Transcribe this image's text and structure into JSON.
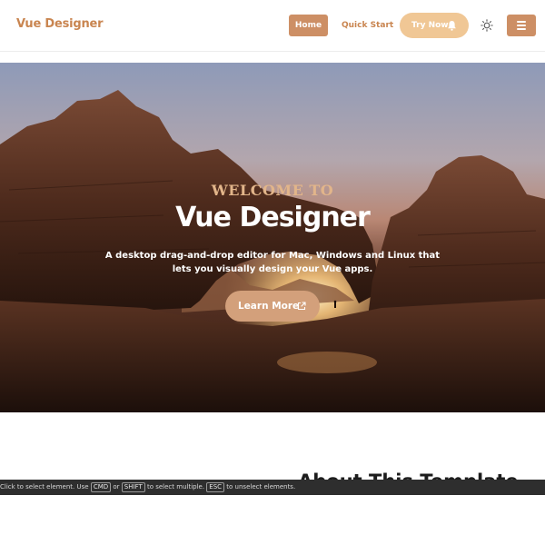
{
  "navbar": {
    "brand": "Vue Designer",
    "home_label": "Home",
    "quick_start_label": "Quick Start",
    "try_now_label": "Try Now",
    "theme_icon": "sun-icon",
    "menu_icon": "hamburger-icon"
  },
  "hero": {
    "kicker": "WELCOME TO",
    "title": "Vue Designer",
    "subtitle": "A desktop drag-and-drop editor for Mac, Windows and Linux that lets you visually design your Vue apps.",
    "button_label": "Learn More",
    "button_icon": "external-link-icon"
  },
  "section": {
    "title": "About This Template"
  },
  "status_bar": {
    "text_1": "Click to select element. Use",
    "key_cmd": "CMD",
    "text_or": "or",
    "key_shift": "SHIFT",
    "text_2": "to select multiple.",
    "key_esc": "ESC",
    "text_3": "to unselect elements."
  },
  "colors": {
    "accent": "#cd8f65",
    "accent_light": "#f0c795",
    "brand_text": "#c98550"
  }
}
